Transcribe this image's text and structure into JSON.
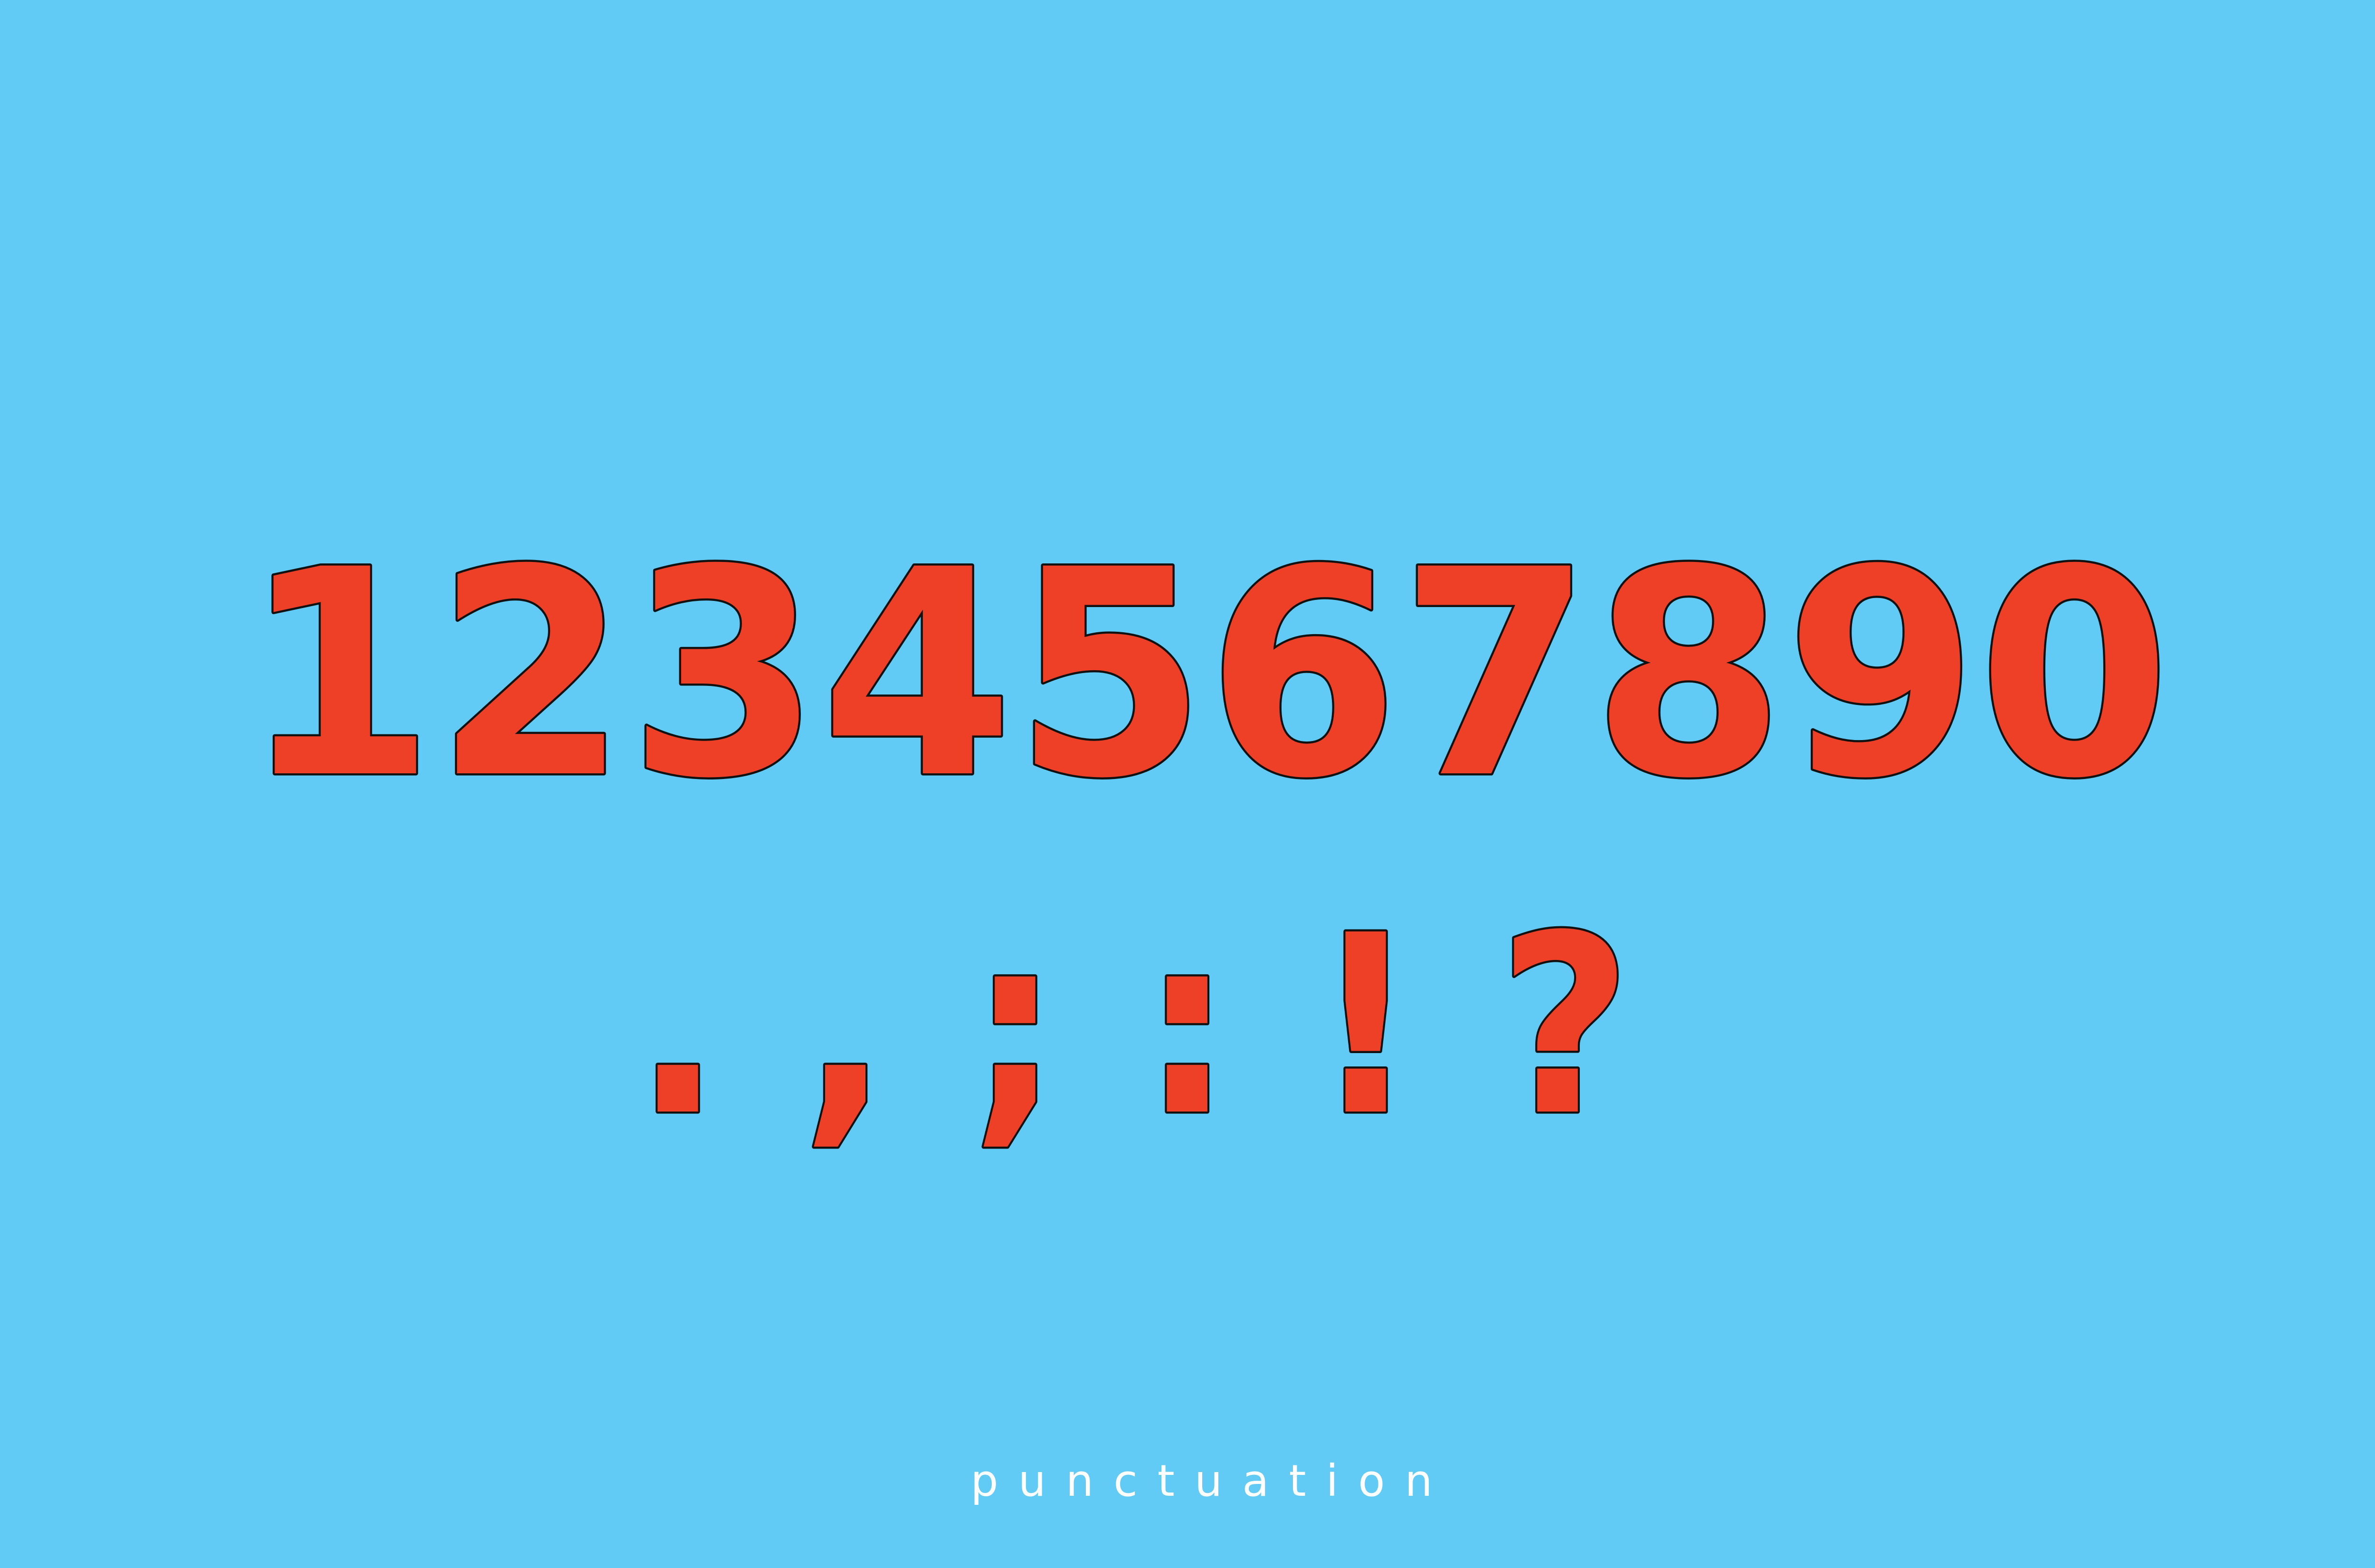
{
  "digits_line": "1234567890",
  "punctuation_line": ". , ; : ! ?",
  "caption": "punctuation",
  "colors": {
    "background": "#62CBF5",
    "glyph_fill": "#EE4027",
    "glyph_outline": "#111111",
    "caption_text": "#FFFFFF"
  }
}
